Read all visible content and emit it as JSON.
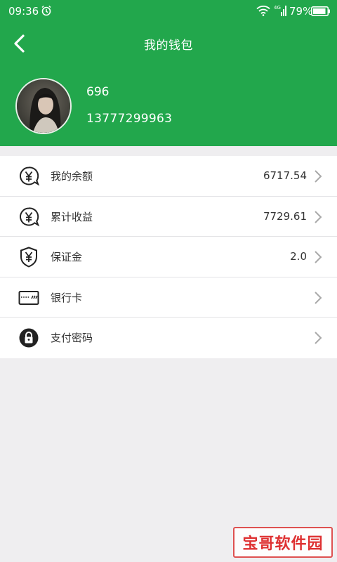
{
  "status": {
    "time": "09:36",
    "battery": "79%"
  },
  "header": {
    "title": "我的钱包",
    "username": "696",
    "phone": "13777299963"
  },
  "menu": [
    {
      "label": "我的余额",
      "value": "6717.54",
      "icon": "yen-bubble-icon"
    },
    {
      "label": "累计收益",
      "value": "7729.61",
      "icon": "yen-bubble-icon"
    },
    {
      "label": "保证金",
      "value": "2.0",
      "icon": "yen-shield-icon"
    },
    {
      "label": "银行卡",
      "value": "",
      "icon": "bank-card-icon"
    },
    {
      "label": "支付密码",
      "value": "",
      "icon": "lock-icon"
    }
  ],
  "watermark": "宝哥软件园",
  "colors": {
    "accent": "#22a74c",
    "background": "#efeef0"
  }
}
